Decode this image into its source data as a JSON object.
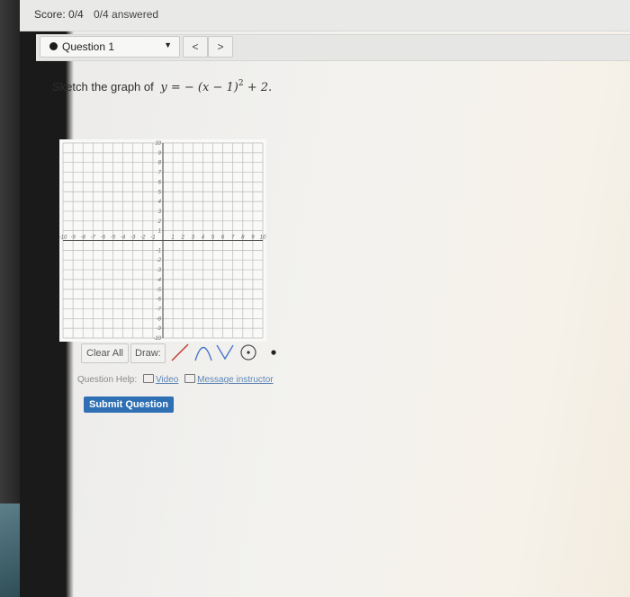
{
  "header": {
    "score": "Score: 0/4",
    "answered": "0/4 answered"
  },
  "question_nav": {
    "selected": "Question 1",
    "prev_label": "<",
    "next_label": ">"
  },
  "question": {
    "prompt": "Sketch the graph of",
    "equation_lhs": "y =",
    "equation_rhs_before": "− (x − 1)",
    "exponent": "2",
    "equation_rhs_after": "+ 2."
  },
  "graph": {
    "x_ticks": [
      "-10",
      "-9",
      "-8",
      "-7",
      "-6",
      "-5",
      "-4",
      "-3",
      "-2",
      "-1",
      "1",
      "2",
      "3",
      "4",
      "5",
      "6",
      "7",
      "8",
      "9",
      "10"
    ],
    "y_ticks": [
      "10",
      "9",
      "8",
      "7",
      "6",
      "5",
      "4",
      "3",
      "2",
      "1",
      "-1",
      "-2",
      "-3",
      "-4",
      "-5",
      "-6",
      "-7",
      "-8",
      "-9",
      "-10"
    ],
    "x_range": [
      -10,
      10
    ],
    "y_range": [
      -10,
      10
    ],
    "grid": true
  },
  "tools": {
    "clear_all": "Clear All",
    "draw_label": "Draw:",
    "items": [
      "line-tool-icon",
      "parabola-up-tool-icon",
      "parabola-down-tool-icon",
      "circle-tool-icon",
      "point-tool-icon"
    ]
  },
  "help": {
    "label": "Question Help:",
    "video": "Video",
    "message": "Message instructor"
  },
  "submit_label": "Submit Question",
  "colors": {
    "submit_bg": "#2f6fb3",
    "link": "#5d86b5",
    "line_tool": "#c0392b"
  }
}
